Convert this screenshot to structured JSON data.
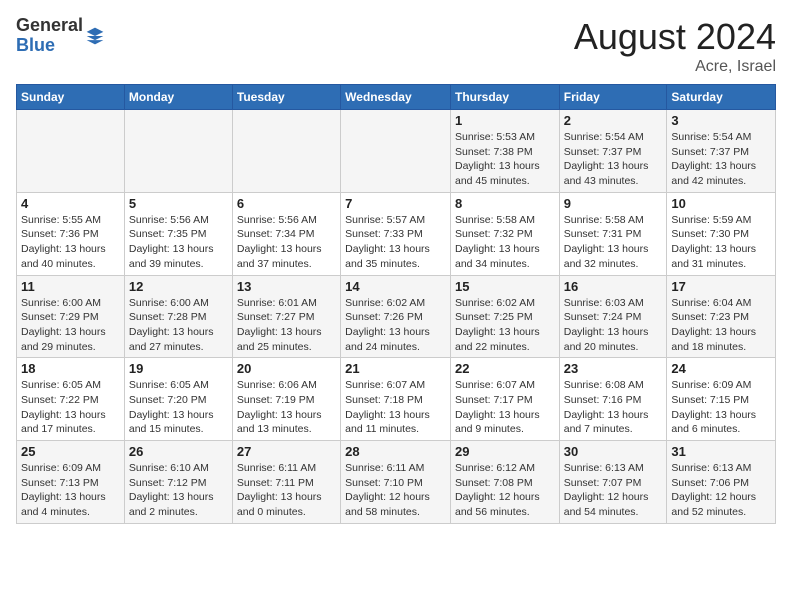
{
  "header": {
    "logo": {
      "general": "General",
      "blue": "Blue"
    },
    "month_year": "August 2024",
    "location": "Acre, Israel"
  },
  "weekdays": [
    "Sunday",
    "Monday",
    "Tuesday",
    "Wednesday",
    "Thursday",
    "Friday",
    "Saturday"
  ],
  "weeks": [
    [
      {
        "day": "",
        "info": ""
      },
      {
        "day": "",
        "info": ""
      },
      {
        "day": "",
        "info": ""
      },
      {
        "day": "",
        "info": ""
      },
      {
        "day": "1",
        "info": "Sunrise: 5:53 AM\nSunset: 7:38 PM\nDaylight: 13 hours\nand 45 minutes."
      },
      {
        "day": "2",
        "info": "Sunrise: 5:54 AM\nSunset: 7:37 PM\nDaylight: 13 hours\nand 43 minutes."
      },
      {
        "day": "3",
        "info": "Sunrise: 5:54 AM\nSunset: 7:37 PM\nDaylight: 13 hours\nand 42 minutes."
      }
    ],
    [
      {
        "day": "4",
        "info": "Sunrise: 5:55 AM\nSunset: 7:36 PM\nDaylight: 13 hours\nand 40 minutes."
      },
      {
        "day": "5",
        "info": "Sunrise: 5:56 AM\nSunset: 7:35 PM\nDaylight: 13 hours\nand 39 minutes."
      },
      {
        "day": "6",
        "info": "Sunrise: 5:56 AM\nSunset: 7:34 PM\nDaylight: 13 hours\nand 37 minutes."
      },
      {
        "day": "7",
        "info": "Sunrise: 5:57 AM\nSunset: 7:33 PM\nDaylight: 13 hours\nand 35 minutes."
      },
      {
        "day": "8",
        "info": "Sunrise: 5:58 AM\nSunset: 7:32 PM\nDaylight: 13 hours\nand 34 minutes."
      },
      {
        "day": "9",
        "info": "Sunrise: 5:58 AM\nSunset: 7:31 PM\nDaylight: 13 hours\nand 32 minutes."
      },
      {
        "day": "10",
        "info": "Sunrise: 5:59 AM\nSunset: 7:30 PM\nDaylight: 13 hours\nand 31 minutes."
      }
    ],
    [
      {
        "day": "11",
        "info": "Sunrise: 6:00 AM\nSunset: 7:29 PM\nDaylight: 13 hours\nand 29 minutes."
      },
      {
        "day": "12",
        "info": "Sunrise: 6:00 AM\nSunset: 7:28 PM\nDaylight: 13 hours\nand 27 minutes."
      },
      {
        "day": "13",
        "info": "Sunrise: 6:01 AM\nSunset: 7:27 PM\nDaylight: 13 hours\nand 25 minutes."
      },
      {
        "day": "14",
        "info": "Sunrise: 6:02 AM\nSunset: 7:26 PM\nDaylight: 13 hours\nand 24 minutes."
      },
      {
        "day": "15",
        "info": "Sunrise: 6:02 AM\nSunset: 7:25 PM\nDaylight: 13 hours\nand 22 minutes."
      },
      {
        "day": "16",
        "info": "Sunrise: 6:03 AM\nSunset: 7:24 PM\nDaylight: 13 hours\nand 20 minutes."
      },
      {
        "day": "17",
        "info": "Sunrise: 6:04 AM\nSunset: 7:23 PM\nDaylight: 13 hours\nand 18 minutes."
      }
    ],
    [
      {
        "day": "18",
        "info": "Sunrise: 6:05 AM\nSunset: 7:22 PM\nDaylight: 13 hours\nand 17 minutes."
      },
      {
        "day": "19",
        "info": "Sunrise: 6:05 AM\nSunset: 7:20 PM\nDaylight: 13 hours\nand 15 minutes."
      },
      {
        "day": "20",
        "info": "Sunrise: 6:06 AM\nSunset: 7:19 PM\nDaylight: 13 hours\nand 13 minutes."
      },
      {
        "day": "21",
        "info": "Sunrise: 6:07 AM\nSunset: 7:18 PM\nDaylight: 13 hours\nand 11 minutes."
      },
      {
        "day": "22",
        "info": "Sunrise: 6:07 AM\nSunset: 7:17 PM\nDaylight: 13 hours\nand 9 minutes."
      },
      {
        "day": "23",
        "info": "Sunrise: 6:08 AM\nSunset: 7:16 PM\nDaylight: 13 hours\nand 7 minutes."
      },
      {
        "day": "24",
        "info": "Sunrise: 6:09 AM\nSunset: 7:15 PM\nDaylight: 13 hours\nand 6 minutes."
      }
    ],
    [
      {
        "day": "25",
        "info": "Sunrise: 6:09 AM\nSunset: 7:13 PM\nDaylight: 13 hours\nand 4 minutes."
      },
      {
        "day": "26",
        "info": "Sunrise: 6:10 AM\nSunset: 7:12 PM\nDaylight: 13 hours\nand 2 minutes."
      },
      {
        "day": "27",
        "info": "Sunrise: 6:11 AM\nSunset: 7:11 PM\nDaylight: 13 hours\nand 0 minutes."
      },
      {
        "day": "28",
        "info": "Sunrise: 6:11 AM\nSunset: 7:10 PM\nDaylight: 12 hours\nand 58 minutes."
      },
      {
        "day": "29",
        "info": "Sunrise: 6:12 AM\nSunset: 7:08 PM\nDaylight: 12 hours\nand 56 minutes."
      },
      {
        "day": "30",
        "info": "Sunrise: 6:13 AM\nSunset: 7:07 PM\nDaylight: 12 hours\nand 54 minutes."
      },
      {
        "day": "31",
        "info": "Sunrise: 6:13 AM\nSunset: 7:06 PM\nDaylight: 12 hours\nand 52 minutes."
      }
    ]
  ]
}
